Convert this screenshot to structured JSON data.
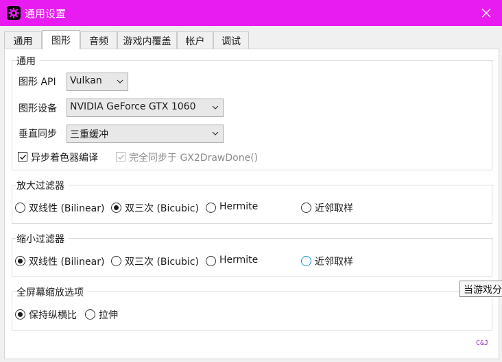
{
  "window": {
    "title": "通用设置",
    "accent": "#e81cf0"
  },
  "tabs": [
    "通用",
    "图形",
    "音频",
    "游戏内覆盖",
    "帐户",
    "调试"
  ],
  "general": {
    "title": "通用",
    "api_label": "图形 API",
    "api_value": "Vulkan",
    "device_label": "图形设备",
    "device_value": "NVIDIA GeForce GTX 1060",
    "vsync_label": "垂直同步",
    "vsync_value": "三重缓冲",
    "async_label": "异步着色器编译",
    "fullsync_label": "完全同步于 GX2DrawDone()"
  },
  "upscale": {
    "title": "放大过滤器",
    "options": [
      "双线性 (Bilinear)",
      "双三次 (Bicubic)",
      "Hermite",
      "近邻取样"
    ],
    "selected": "双三次 (Bicubic)"
  },
  "downscale": {
    "title": "缩小过滤器",
    "options": [
      "双线性 (Bilinear)",
      "双三次 (Bicubic)",
      "Hermite",
      "近邻取样"
    ],
    "selected": "双线性 (Bilinear)"
  },
  "fullscreen": {
    "title": "全屏幕缩放选项",
    "options": [
      "保持纵横比",
      "拉伸"
    ],
    "selected": "保持纵横比"
  },
  "tooltip_text": "当游戏分",
  "logo_text": "C&J"
}
